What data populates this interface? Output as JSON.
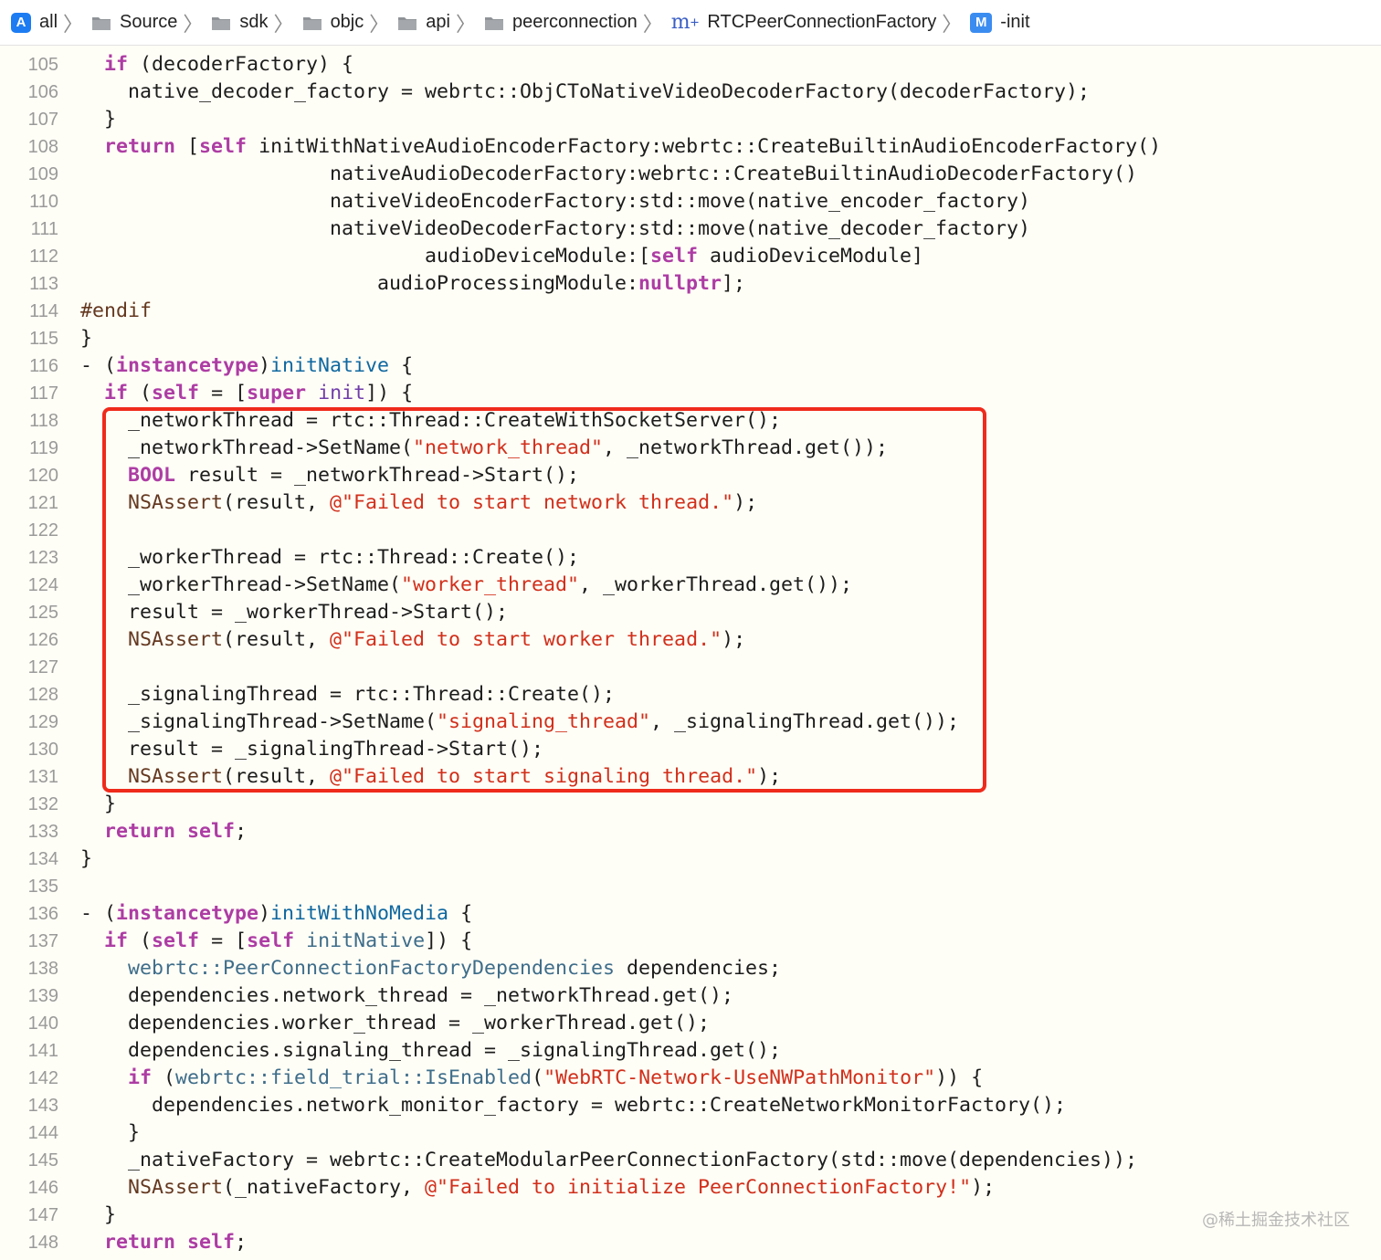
{
  "breadcrumb": {
    "items": [
      {
        "label": "all",
        "icon": "app-icon"
      },
      {
        "label": "Source",
        "icon": "folder-icon"
      },
      {
        "label": "sdk",
        "icon": "folder-icon"
      },
      {
        "label": "objc",
        "icon": "folder-icon"
      },
      {
        "label": "api",
        "icon": "folder-icon"
      },
      {
        "label": "peerconnection",
        "icon": "folder-icon"
      },
      {
        "label": "RTCPeerConnectionFactory",
        "icon": "objc-implementation-file-icon",
        "icon_text": "m"
      },
      {
        "label": "-init",
        "icon": "method-icon",
        "icon_text": "M"
      }
    ],
    "separator": "〉"
  },
  "editor": {
    "lines": [
      {
        "n": "105",
        "tokens": [
          {
            "t": "  "
          },
          {
            "t": "if",
            "c": "kw"
          },
          {
            "t": " (decoderFactory) {"
          }
        ]
      },
      {
        "n": "106",
        "tokens": [
          {
            "t": "    native_decoder_factory = webrtc::ObjCToNativeVideoDecoderFactory(decoderFactory);"
          }
        ]
      },
      {
        "n": "107",
        "tokens": [
          {
            "t": "  }"
          }
        ]
      },
      {
        "n": "108",
        "tokens": [
          {
            "t": "  "
          },
          {
            "t": "return",
            "c": "kw"
          },
          {
            "t": " ["
          },
          {
            "t": "self",
            "c": "kw"
          },
          {
            "t": " initWithNativeAudioEncoderFactory:webrtc::CreateBuiltinAudioEncoderFactory()"
          }
        ]
      },
      {
        "n": "109",
        "tokens": [
          {
            "t": "                     nativeAudioDecoderFactory:webrtc::CreateBuiltinAudioDecoderFactory()"
          }
        ]
      },
      {
        "n": "110",
        "tokens": [
          {
            "t": "                     nativeVideoEncoderFactory:std::move(native_encoder_factory)"
          }
        ]
      },
      {
        "n": "111",
        "tokens": [
          {
            "t": "                     nativeVideoDecoderFactory:std::move(native_decoder_factory)"
          }
        ]
      },
      {
        "n": "112",
        "tokens": [
          {
            "t": "                             audioDeviceModule:["
          },
          {
            "t": "self",
            "c": "kw"
          },
          {
            "t": " audioDeviceModule]"
          }
        ]
      },
      {
        "n": "113",
        "tokens": [
          {
            "t": "                         audioProcessingModule:"
          },
          {
            "t": "nullptr",
            "c": "kw"
          },
          {
            "t": "];"
          }
        ]
      },
      {
        "n": "114",
        "tokens": [
          {
            "t": "#endif",
            "c": "pre"
          }
        ]
      },
      {
        "n": "115",
        "tokens": [
          {
            "t": "}"
          }
        ]
      },
      {
        "n": "116",
        "tokens": [
          {
            "t": "- ("
          },
          {
            "t": "instancetype",
            "c": "kw"
          },
          {
            "t": ")"
          },
          {
            "t": "initNative",
            "c": "fnd"
          },
          {
            "t": " {"
          }
        ]
      },
      {
        "n": "117",
        "tokens": [
          {
            "t": "  "
          },
          {
            "t": "if",
            "c": "kw"
          },
          {
            "t": " ("
          },
          {
            "t": "self",
            "c": "kw"
          },
          {
            "t": " = ["
          },
          {
            "t": "super",
            "c": "kw"
          },
          {
            "t": " "
          },
          {
            "t": "init",
            "c": "type"
          },
          {
            "t": "]) {"
          }
        ]
      },
      {
        "n": "118",
        "tokens": [
          {
            "t": "    _networkThread = rtc::Thread::CreateWithSocketServer();"
          }
        ]
      },
      {
        "n": "119",
        "tokens": [
          {
            "t": "    _networkThread->SetName("
          },
          {
            "t": "\"network_thread\"",
            "c": "str"
          },
          {
            "t": ", _networkThread.get());"
          }
        ]
      },
      {
        "n": "120",
        "tokens": [
          {
            "t": "    "
          },
          {
            "t": "BOOL",
            "c": "kw"
          },
          {
            "t": " result = _networkThread->Start();"
          }
        ]
      },
      {
        "n": "121",
        "tokens": [
          {
            "t": "    "
          },
          {
            "t": "NSAssert",
            "c": "pre"
          },
          {
            "t": "(result, "
          },
          {
            "t": "@\"Failed to start network thread.\"",
            "c": "str"
          },
          {
            "t": ");"
          }
        ]
      },
      {
        "n": "122",
        "tokens": [
          {
            "t": ""
          }
        ]
      },
      {
        "n": "123",
        "tokens": [
          {
            "t": "    _workerThread = rtc::Thread::Create();"
          }
        ]
      },
      {
        "n": "124",
        "tokens": [
          {
            "t": "    _workerThread->SetName("
          },
          {
            "t": "\"worker_thread\"",
            "c": "str"
          },
          {
            "t": ", _workerThread.get());"
          }
        ]
      },
      {
        "n": "125",
        "tokens": [
          {
            "t": "    result = _workerThread->Start();"
          }
        ]
      },
      {
        "n": "126",
        "tokens": [
          {
            "t": "    "
          },
          {
            "t": "NSAssert",
            "c": "pre"
          },
          {
            "t": "(result, "
          },
          {
            "t": "@\"Failed to start worker thread.\"",
            "c": "str"
          },
          {
            "t": ");"
          }
        ]
      },
      {
        "n": "127",
        "tokens": [
          {
            "t": ""
          }
        ]
      },
      {
        "n": "128",
        "tokens": [
          {
            "t": "    _signalingThread = rtc::Thread::Create();"
          }
        ]
      },
      {
        "n": "129",
        "tokens": [
          {
            "t": "    _signalingThread->SetName("
          },
          {
            "t": "\"signaling_thread\"",
            "c": "str"
          },
          {
            "t": ", _signalingThread.get());"
          }
        ]
      },
      {
        "n": "130",
        "tokens": [
          {
            "t": "    result = _signalingThread->Start();"
          }
        ]
      },
      {
        "n": "131",
        "tokens": [
          {
            "t": "    "
          },
          {
            "t": "NSAssert",
            "c": "pre"
          },
          {
            "t": "(result, "
          },
          {
            "t": "@\"Failed to start signaling thread.\"",
            "c": "str"
          },
          {
            "t": ");"
          }
        ]
      },
      {
        "n": "132",
        "tokens": [
          {
            "t": "  }"
          }
        ]
      },
      {
        "n": "133",
        "tokens": [
          {
            "t": "  "
          },
          {
            "t": "return",
            "c": "kw"
          },
          {
            "t": " "
          },
          {
            "t": "self",
            "c": "kw"
          },
          {
            "t": ";"
          }
        ]
      },
      {
        "n": "134",
        "tokens": [
          {
            "t": "}"
          }
        ]
      },
      {
        "n": "135",
        "tokens": [
          {
            "t": ""
          }
        ]
      },
      {
        "n": "136",
        "tokens": [
          {
            "t": "- ("
          },
          {
            "t": "instancetype",
            "c": "kw"
          },
          {
            "t": ")"
          },
          {
            "t": "initWithNoMedia",
            "c": "fnd"
          },
          {
            "t": " {"
          }
        ]
      },
      {
        "n": "137",
        "tokens": [
          {
            "t": "  "
          },
          {
            "t": "if",
            "c": "kw"
          },
          {
            "t": " ("
          },
          {
            "t": "self",
            "c": "kw"
          },
          {
            "t": " = ["
          },
          {
            "t": "self",
            "c": "kw"
          },
          {
            "t": " "
          },
          {
            "t": "initNative",
            "c": "fn"
          },
          {
            "t": "]) {"
          }
        ]
      },
      {
        "n": "138",
        "tokens": [
          {
            "t": "    "
          },
          {
            "t": "webrtc::PeerConnectionFactoryDependencies",
            "c": "fn"
          },
          {
            "t": " dependencies;"
          }
        ]
      },
      {
        "n": "139",
        "tokens": [
          {
            "t": "    dependencies.network_thread = _networkThread.get();"
          }
        ]
      },
      {
        "n": "140",
        "tokens": [
          {
            "t": "    dependencies.worker_thread = _workerThread.get();"
          }
        ]
      },
      {
        "n": "141",
        "tokens": [
          {
            "t": "    dependencies.signaling_thread = _signalingThread.get();"
          }
        ]
      },
      {
        "n": "142",
        "tokens": [
          {
            "t": "    "
          },
          {
            "t": "if",
            "c": "kw"
          },
          {
            "t": " ("
          },
          {
            "t": "webrtc::field_trial::IsEnabled",
            "c": "fn"
          },
          {
            "t": "("
          },
          {
            "t": "\"WebRTC-Network-UseNWPathMonitor\"",
            "c": "str"
          },
          {
            "t": ")) {"
          }
        ]
      },
      {
        "n": "143",
        "tokens": [
          {
            "t": "      dependencies.network_monitor_factory = webrtc::CreateNetworkMonitorFactory();"
          }
        ]
      },
      {
        "n": "144",
        "tokens": [
          {
            "t": "    }"
          }
        ]
      },
      {
        "n": "145",
        "tokens": [
          {
            "t": "    _nativeFactory = webrtc::CreateModularPeerConnectionFactory(std::move(dependencies));"
          }
        ]
      },
      {
        "n": "146",
        "tokens": [
          {
            "t": "    "
          },
          {
            "t": "NSAssert",
            "c": "pre"
          },
          {
            "t": "(_nativeFactory, "
          },
          {
            "t": "@\"Failed to initialize PeerConnectionFactory!\"",
            "c": "str"
          },
          {
            "t": ");"
          }
        ]
      },
      {
        "n": "147",
        "tokens": [
          {
            "t": "  }"
          }
        ]
      },
      {
        "n": "148",
        "tokens": [
          {
            "t": "  "
          },
          {
            "t": "return",
            "c": "kw"
          },
          {
            "t": " "
          },
          {
            "t": "self",
            "c": "kw"
          },
          {
            "t": ";"
          }
        ]
      }
    ]
  },
  "annotation": {
    "color": "#ef2b1c"
  },
  "colors": {
    "keyword": "#ad3da4",
    "string": "#d12f1b",
    "function": "#3e6d8a",
    "background": "#fffef6"
  },
  "watermark": "@稀土掘金技术社区"
}
